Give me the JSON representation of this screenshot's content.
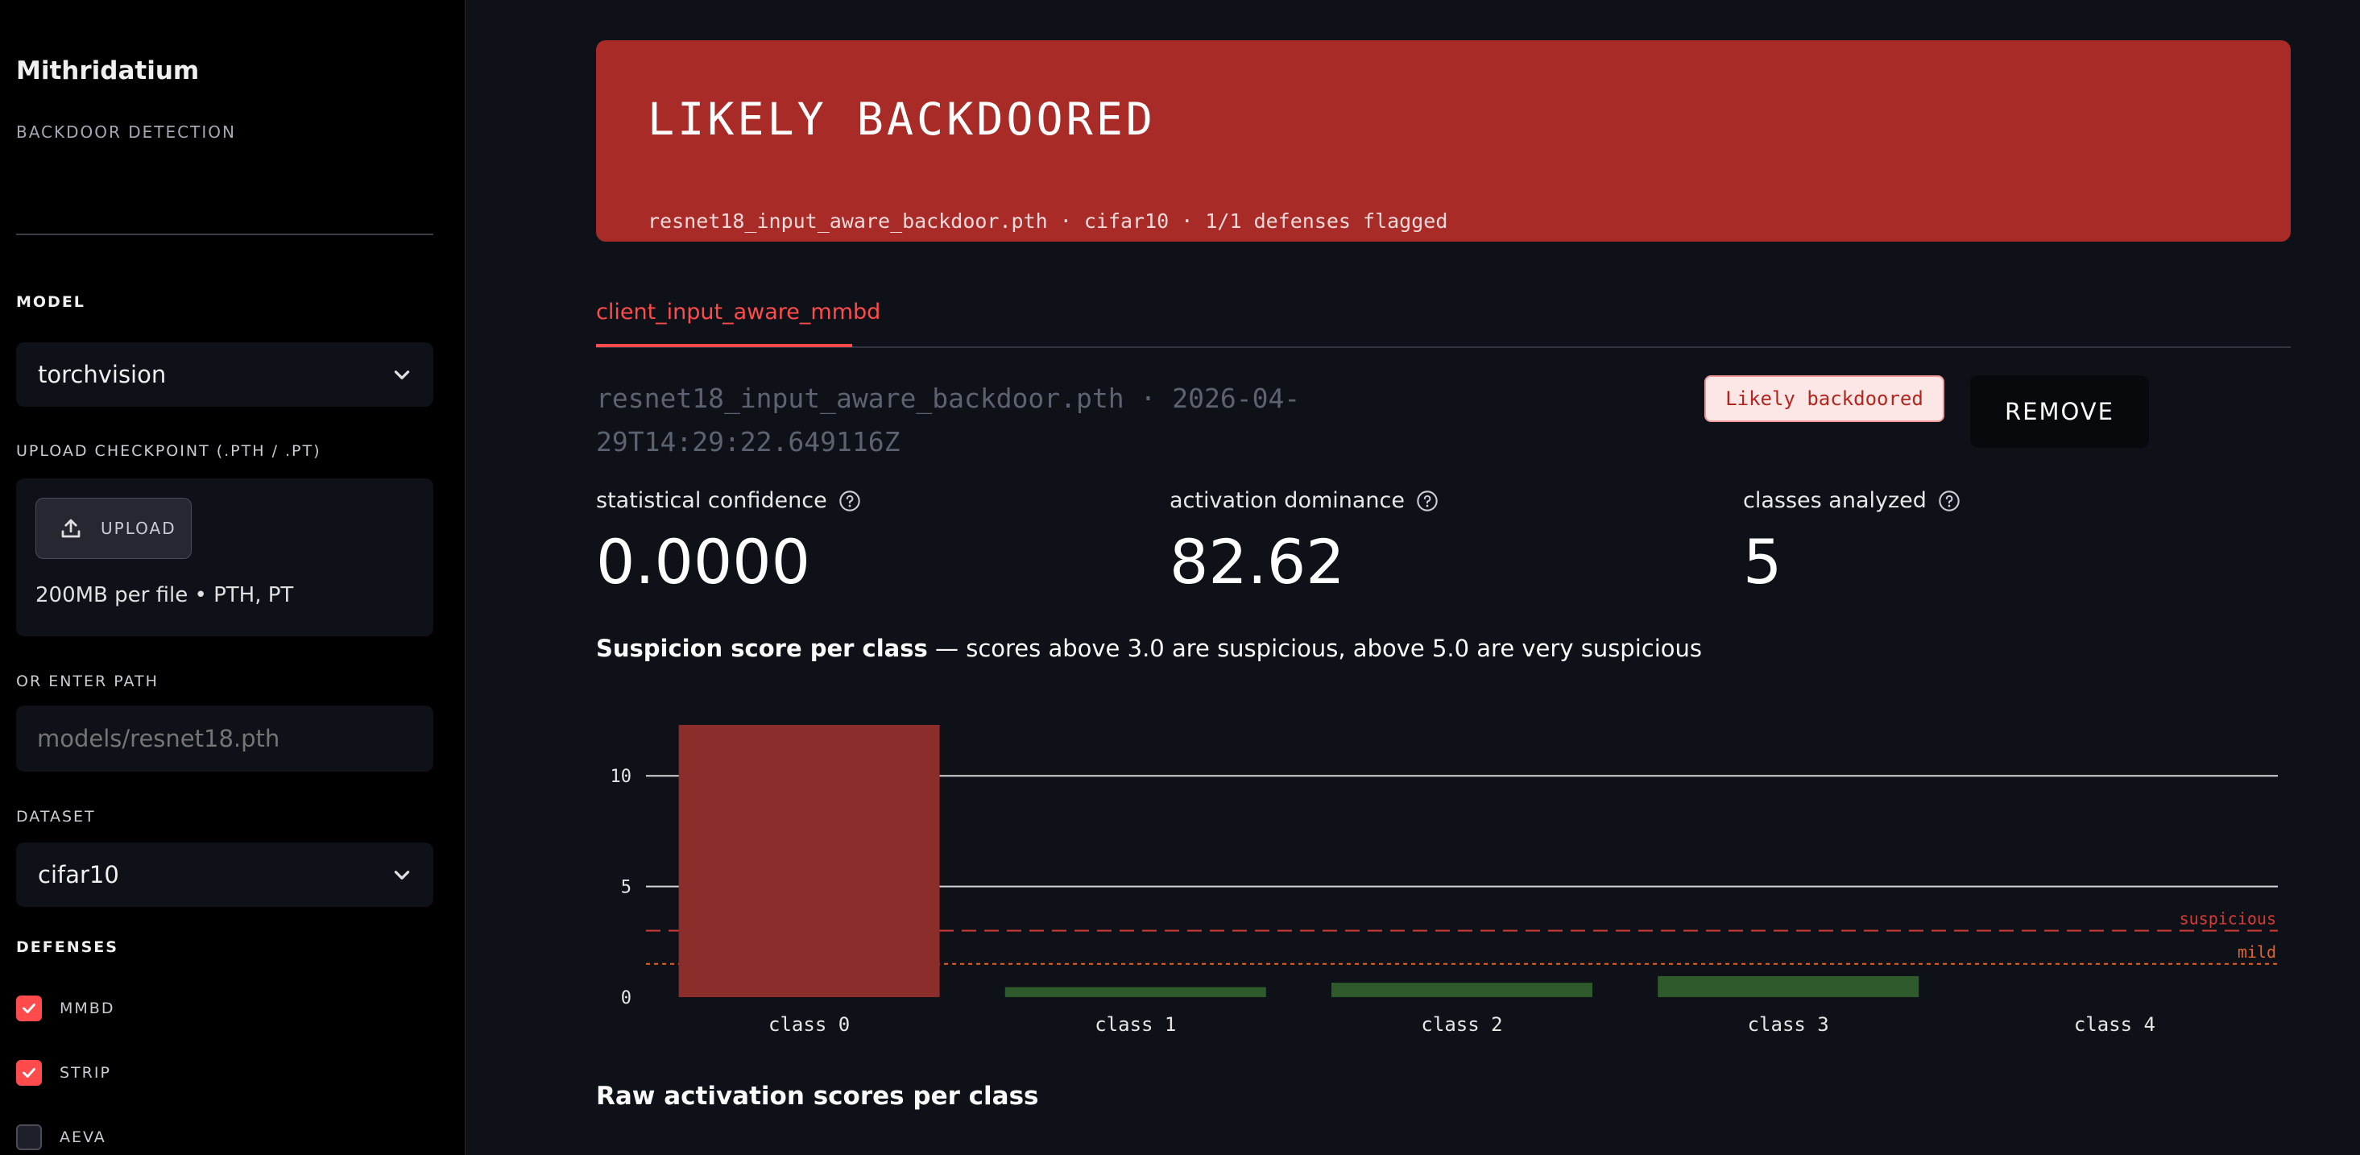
{
  "sidebar": {
    "app_title": "Mithridatium",
    "app_subtitle": "BACKDOOR DETECTION",
    "model_label": "MODEL",
    "model_value": "torchvision",
    "upload_label": "UPLOAD CHECKPOINT (.PTH / .PT)",
    "upload_button": "UPLOAD",
    "upload_hint": "200MB per file • PTH, PT",
    "path_label": "OR ENTER PATH",
    "path_placeholder": "models/resnet18.pth",
    "dataset_label": "DATASET",
    "dataset_value": "cifar10",
    "defenses_label": "DEFENSES",
    "defenses": [
      {
        "label": "MMBD",
        "checked": true
      },
      {
        "label": "STRIP",
        "checked": true
      },
      {
        "label": "AEVA",
        "checked": false
      }
    ]
  },
  "banner": {
    "title": "LIKELY BACKDOORED",
    "meta": "resnet18_input_aware_backdoor.pth  ·  cifar10  ·  1/1 defenses flagged",
    "color": "#a82b28"
  },
  "tabs": [
    {
      "label": "client_input_aware_mmbd",
      "active": true
    }
  ],
  "run": {
    "meta": "resnet18_input_aware_backdoor.pth  ·  2026-04-29T14:29:22.649116Z",
    "badge": "Likely backdoored",
    "remove_label": "REMOVE"
  },
  "metrics": [
    {
      "label": "statistical confidence",
      "value": "0.0000"
    },
    {
      "label": "activation dominance",
      "value": "82.62"
    },
    {
      "label": "classes analyzed",
      "value": "5"
    }
  ],
  "chart_title_bold": "Suspicion score per class",
  "chart_title_rest": " — scores above 3.0 are suspicious, above 5.0 are very suspicious",
  "raw_title": "Raw activation scores per class",
  "chart_data": {
    "type": "bar",
    "categories": [
      "class 0",
      "class 1",
      "class 2",
      "class 3",
      "class 4"
    ],
    "values": [
      12.3,
      0.45,
      0.65,
      0.95,
      0.0
    ],
    "bar_colors": [
      "#8b2e2b",
      "#2f5a2b",
      "#2f5a2b",
      "#2f5a2b",
      "#2f5a2b"
    ],
    "yticks": [
      0,
      5,
      10
    ],
    "ylim": [
      0,
      12.3
    ],
    "thresholds": [
      {
        "label": "suspicious",
        "value": 3.0,
        "color": "#d63b35"
      },
      {
        "label": "mild",
        "value": 1.5,
        "color": "#e0662e"
      }
    ]
  }
}
